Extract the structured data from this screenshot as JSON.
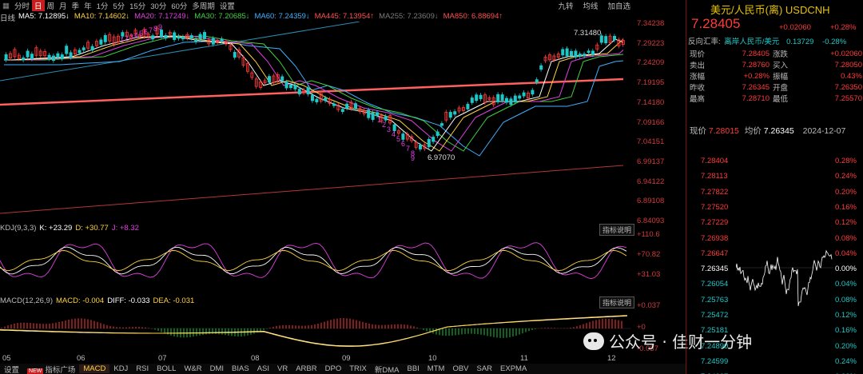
{
  "toolbar": {
    "tabs": [
      {
        "label": "分时",
        "active": false
      },
      {
        "label": "日",
        "active": true
      },
      {
        "label": "周",
        "active": false
      },
      {
        "label": "月",
        "active": false
      },
      {
        "label": "季",
        "active": false
      },
      {
        "label": "年",
        "active": false
      },
      {
        "label": "1分",
        "active": false
      },
      {
        "label": "5分",
        "active": false
      },
      {
        "label": "15分",
        "active": false
      },
      {
        "label": "30分",
        "active": false
      },
      {
        "label": "60分",
        "active": false
      },
      {
        "label": "多周期",
        "active": false
      },
      {
        "label": "设置",
        "active": false
      }
    ],
    "right_buttons": [
      "九转",
      "均线",
      "加自选"
    ]
  },
  "ma": {
    "period_label": "日线",
    "items": [
      {
        "text": "MA5: 7.12895",
        "arrow": "↓",
        "color": "#ffffff"
      },
      {
        "text": "MA10: 7.14602",
        "arrow": "↓",
        "color": "#ffd23c"
      },
      {
        "text": "MA20: 7.17249",
        "arrow": "↓",
        "color": "#e040e0"
      },
      {
        "text": "MA30: 7.20685",
        "arrow": "↓",
        "color": "#40d040"
      },
      {
        "text": "MA60: 7.24359",
        "arrow": "↓",
        "color": "#40b0ff"
      },
      {
        "text": "MA445: 7.13954",
        "arrow": "↑",
        "color": "#ff5050"
      },
      {
        "text": "MA255: 7.23609",
        "arrow": "↓",
        "color": "#7a7a7a"
      },
      {
        "text": "MA850: 6.88694",
        "arrow": "↑",
        "color": "#ff5050"
      }
    ]
  },
  "price_axis": [
    "7.34238",
    "7.29223",
    "7.24209",
    "7.19195",
    "7.14180",
    "7.09166",
    "7.04151",
    "6.99137",
    "6.94122",
    "6.89108",
    "6.84093"
  ],
  "annotations": {
    "high": "7.31480",
    "low": "6.97070"
  },
  "nine_turn_labels": [
    {
      "t": "1",
      "c": "#e040e0"
    },
    {
      "t": "2",
      "c": "#e040e0"
    },
    {
      "t": "3",
      "c": "#e040e0"
    },
    {
      "t": "4",
      "c": "#e040e0"
    },
    {
      "t": "5",
      "c": "#e040e0"
    },
    {
      "t": "6",
      "c": "#e040e0"
    },
    {
      "t": "7",
      "c": "#e040e0"
    },
    {
      "t": "8",
      "c": "#e040e0"
    },
    {
      "t": "9",
      "c": "#e040e0"
    }
  ],
  "kdj": {
    "label": "KDJ(9,3,3)",
    "k": "K: +23.29",
    "d": "D: +30.77",
    "j": "J: +8.32",
    "button": "指标说明",
    "axis": [
      "+110.6",
      "+70.82",
      "+31.03"
    ]
  },
  "macd": {
    "label": "MACD(12,26,9)",
    "macd": "MACD: -0.004",
    "diff": "DIFF: -0.033",
    "dea": "DEA: -0.031",
    "button": "指标说明",
    "axis": [
      "+0.037",
      "+0",
      "-0.037"
    ]
  },
  "x_dates": [
    "05",
    "06",
    "07",
    "08",
    "09",
    "10",
    "11",
    "12"
  ],
  "bottom_tabs": [
    {
      "label": "设置",
      "active": false,
      "badge": ""
    },
    {
      "label": "指标广场",
      "active": false,
      "badge": "NEW"
    },
    {
      "label": "MACD",
      "active": true,
      "badge": ""
    },
    {
      "label": "KDJ",
      "active": false,
      "badge": ""
    },
    {
      "label": "RSI",
      "active": false,
      "badge": ""
    },
    {
      "label": "BOLL",
      "active": false,
      "badge": ""
    },
    {
      "label": "W&R",
      "active": false,
      "badge": ""
    },
    {
      "label": "DMI",
      "active": false,
      "badge": ""
    },
    {
      "label": "BIAS",
      "active": false,
      "badge": ""
    },
    {
      "label": "ASI",
      "active": false,
      "badge": ""
    },
    {
      "label": "VR",
      "active": false,
      "badge": ""
    },
    {
      "label": "ARBR",
      "active": false,
      "badge": ""
    },
    {
      "label": "DPO",
      "active": false,
      "badge": ""
    },
    {
      "label": "TRIX",
      "active": false,
      "badge": ""
    },
    {
      "label": "新DMA",
      "active": false,
      "badge": ""
    },
    {
      "label": "BBI",
      "active": false,
      "badge": ""
    },
    {
      "label": "MTM",
      "active": false,
      "badge": ""
    },
    {
      "label": "OBV",
      "active": false,
      "badge": ""
    },
    {
      "label": "SAR",
      "active": false,
      "badge": ""
    },
    {
      "label": "EXPMA",
      "active": false,
      "badge": ""
    }
  ],
  "quote": {
    "title": "美元/人民币(离) USDCNH",
    "price": "7.28405",
    "change": "+0.02060",
    "change_pct": "+0.28%",
    "rate_label": "反向汇率:",
    "rate_pair": "离岸人民币/美元",
    "rate_value": "0.13729",
    "rate_pct": "-0.28%",
    "rows": [
      {
        "l1": "现价",
        "v1": "7.28405",
        "l2": "涨跌",
        "v2": "+0.02060"
      },
      {
        "l1": "卖出",
        "v1": "7.28760",
        "l2": "买入",
        "v2": "7.28050"
      },
      {
        "l1": "涨幅",
        "v1": "+0.28%",
        "l2": "振幅",
        "v2": "0.43%"
      },
      {
        "l1": "昨收",
        "v1": "7.26345",
        "l2": "开盘",
        "v2": "7.26350"
      },
      {
        "l1": "最高",
        "v1": "7.28710",
        "l2": "最低",
        "v2": "7.25570"
      }
    ],
    "intraday": {
      "now_label": "现价",
      "now_value": "7.28015",
      "avg_label": "均价",
      "avg_value": "7.26345",
      "date": "2024-12-07",
      "left_axis": [
        "7.28404",
        "7.28113",
        "7.27822",
        "7.27520",
        "7.27229",
        "7.26938",
        "7.26647",
        "7.26345",
        "7.26054",
        "7.25763",
        "7.25472",
        "7.25181",
        "7.24890",
        "7.24599",
        "7.24287"
      ],
      "right_axis": [
        "0.28%",
        "0.24%",
        "0.20%",
        "0.16%",
        "0.12%",
        "0.08%",
        "0.04%",
        "0.00%",
        "0.04%",
        "0.08%",
        "0.12%",
        "0.16%",
        "0.20%",
        "0.24%",
        "0.28%"
      ]
    }
  },
  "watermark": "公众号 · 佳财一分钟",
  "colors": {
    "up": "#ff3b3b",
    "down": "#1ec8c8",
    "accent": "#ffd23c",
    "bg": "#000000"
  }
}
